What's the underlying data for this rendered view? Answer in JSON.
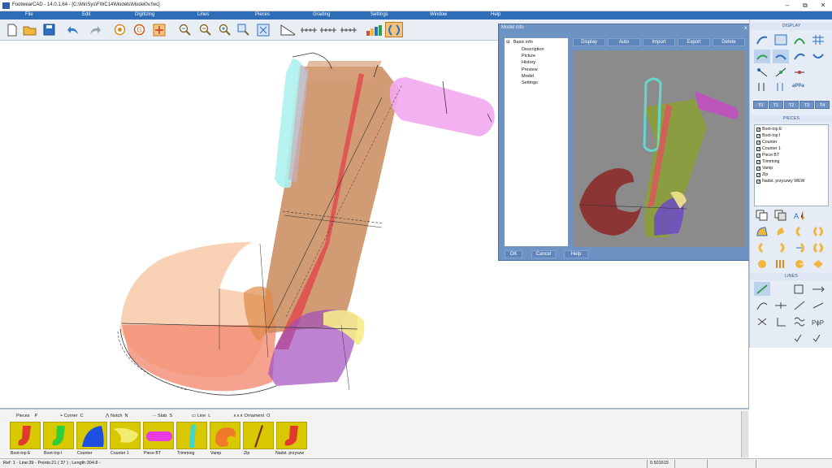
{
  "window": {
    "title": "FootwearCAD - 14.0.1.64 - [C:\\MiriSys\\FWC14\\Models\\Model0v.fwc]"
  },
  "menu": [
    "File",
    "Edit",
    "Digitizing",
    "Lines",
    "Pieces",
    "Grading",
    "Settings",
    "Window",
    "Help"
  ],
  "toolbar_icons": [
    "new-file",
    "open-folder",
    "save",
    "undo",
    "redo",
    "sun",
    "circle-g",
    "move-arrows",
    "zoom-out",
    "zoom-out-2",
    "zoom-in",
    "zoom-window",
    "zoom-fit",
    "ruler-set-square",
    "measure-1",
    "measure-2",
    "measure-3",
    "measure-4",
    "color-bars",
    "curve-pair"
  ],
  "dialog": {
    "title": "Model info",
    "close": "×",
    "tree_root": "Basic info",
    "tree_items": [
      "Description",
      "Picture",
      "History",
      "Preview",
      "Model",
      "Settings"
    ],
    "tabs": [
      "Display",
      "Auto",
      "Import",
      "Export",
      "Delete"
    ],
    "footer_buttons": [
      "OK",
      "Cancel",
      "Help"
    ]
  },
  "right_panel": {
    "display_header": "DISPLAY",
    "text_tool": "aPPa",
    "t_buttons": [
      "T0",
      "T1",
      "T2",
      "T3",
      "T4"
    ],
    "pieces_header": "PIECES",
    "pieces_list": [
      {
        "label": "Boot-top E",
        "checked": true
      },
      {
        "label": "Boot-top I",
        "checked": true
      },
      {
        "label": "Counter",
        "checked": true
      },
      {
        "label": "Counter 1",
        "checked": true
      },
      {
        "label": "Piece BT",
        "checked": true
      },
      {
        "label": "Trimming",
        "checked": true
      },
      {
        "label": "Vamp",
        "checked": true
      },
      {
        "label": "Zip",
        "checked": true
      },
      {
        "label": "Nadst. przyszwy WEW",
        "checked": true
      }
    ],
    "lines_header": "LINES"
  },
  "bottom_tabs": [
    {
      "label": "Pieces",
      "key": "P"
    },
    {
      "label": "Corner",
      "key": "C"
    },
    {
      "label": "Notch",
      "key": "N"
    },
    {
      "label": "Stab",
      "key": "S"
    },
    {
      "label": "Line",
      "key": "L"
    },
    {
      "label": "Ornament",
      "key": "O"
    }
  ],
  "bottom_pieces": [
    {
      "label": "Boot-top E",
      "color": "#e03a2f"
    },
    {
      "label": "Boot-top I",
      "color": "#2fcf3a"
    },
    {
      "label": "Counter",
      "color": "#1d4fe0"
    },
    {
      "label": "Counter 1",
      "color": "#f2ec6e"
    },
    {
      "label": "Piece BT",
      "color": "#e83ce0"
    },
    {
      "label": "Trimming",
      "color": "#3fd6cf"
    },
    {
      "label": "Vamp",
      "color": "#f07a28"
    },
    {
      "label": "Zip",
      "color": "#7b2c17"
    },
    {
      "label": "Nadst. przyszw",
      "color": "#e03a2f"
    }
  ],
  "status": {
    "left": "Ref: 1 - Line:39 - Points:21 ( 37 ) ; Length:304.8 -",
    "value": "0.501615"
  },
  "colors": {
    "menubar": "#2f6db6",
    "dialog": "#6d93c4",
    "accent_blue": "#2f6db6"
  }
}
